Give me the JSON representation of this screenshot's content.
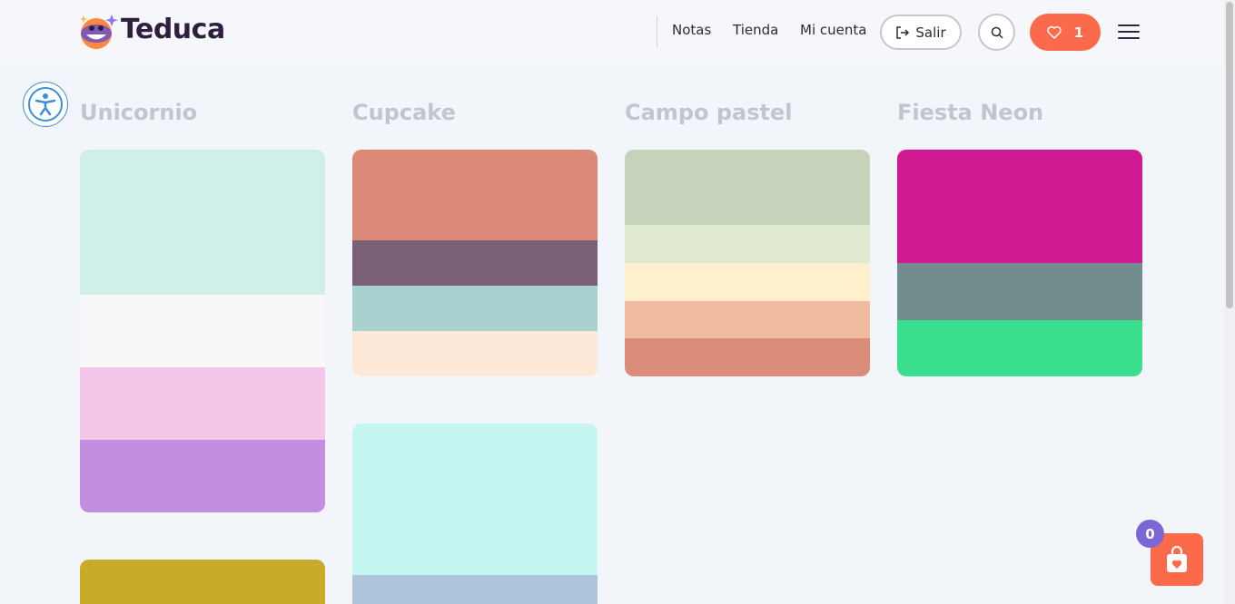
{
  "header": {
    "brand": "Teduca",
    "nav": [
      "Notas",
      "Tienda",
      "Mi cuenta"
    ],
    "logout_label": "Salir",
    "favorites_count": "1"
  },
  "palettes": [
    {
      "title": "Unicornio",
      "colors": [
        "#d1efea",
        "#f8f8f8",
        "#f4c6e7",
        "#c48ee0"
      ]
    },
    {
      "title": "Cupcake",
      "colors": [
        "#d98975",
        "#7a6077",
        "#a8d1cf",
        "#fee9d8"
      ]
    },
    {
      "title": "Campo pastel",
      "colors": [
        "#c6d2b9",
        "#dee9cf",
        "#fff0cd",
        "#f1bba2",
        "#da8c7a"
      ]
    },
    {
      "title": "Fiesta Neon",
      "colors": [
        "#cf1a93",
        "#738c8e",
        "#3adf8d"
      ]
    }
  ],
  "extra_palettes": [
    {
      "colors": [
        "#c7ab2b"
      ]
    },
    {
      "colors": [
        "#c5f6f1",
        "#aec4da"
      ]
    }
  ],
  "cart": {
    "count": "0"
  },
  "colors": {
    "accent": "#fb6a4a",
    "badge": "#7b66d6",
    "title_gray": "#c1c5cd"
  },
  "icons": [
    "logo-mascot-icon",
    "logout-icon",
    "search-icon",
    "heart-icon",
    "menu-icon",
    "accessibility-icon",
    "shopping-bag-icon"
  ]
}
